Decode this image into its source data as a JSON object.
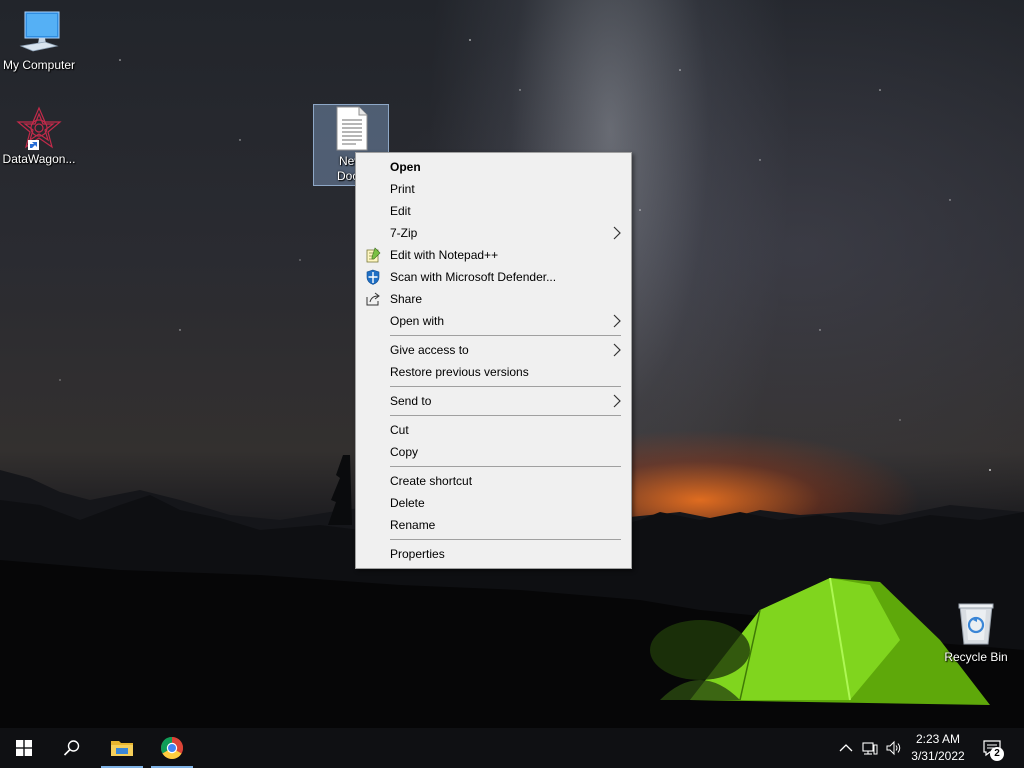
{
  "desktop": {
    "icons": [
      {
        "label": "My Computer"
      },
      {
        "label": "DataWagon..."
      },
      {
        "label": "New\nDocu"
      },
      {
        "label": "Recycle Bin"
      }
    ]
  },
  "context_menu": {
    "items": [
      {
        "label": "Open",
        "bold": true
      },
      {
        "label": "Print"
      },
      {
        "label": "Edit"
      },
      {
        "label": "7-Zip",
        "submenu": true
      },
      {
        "label": "Edit with Notepad++",
        "icon": "notepad-plus-plus-icon"
      },
      {
        "label": "Scan with Microsoft Defender...",
        "icon": "defender-shield-icon"
      },
      {
        "label": "Share",
        "icon": "share-icon"
      },
      {
        "label": "Open with",
        "submenu": true
      },
      {
        "label": "Give access to",
        "submenu": true
      },
      {
        "label": "Restore previous versions"
      },
      {
        "label": "Send to",
        "submenu": true
      },
      {
        "label": "Cut"
      },
      {
        "label": "Copy"
      },
      {
        "label": "Create shortcut"
      },
      {
        "label": "Delete"
      },
      {
        "label": "Rename"
      },
      {
        "label": "Properties"
      }
    ]
  },
  "taskbar": {
    "clock_time": "2:23 AM",
    "clock_date": "3/31/2022",
    "notification_count": "2",
    "accent_color": "#7fb2e5"
  }
}
